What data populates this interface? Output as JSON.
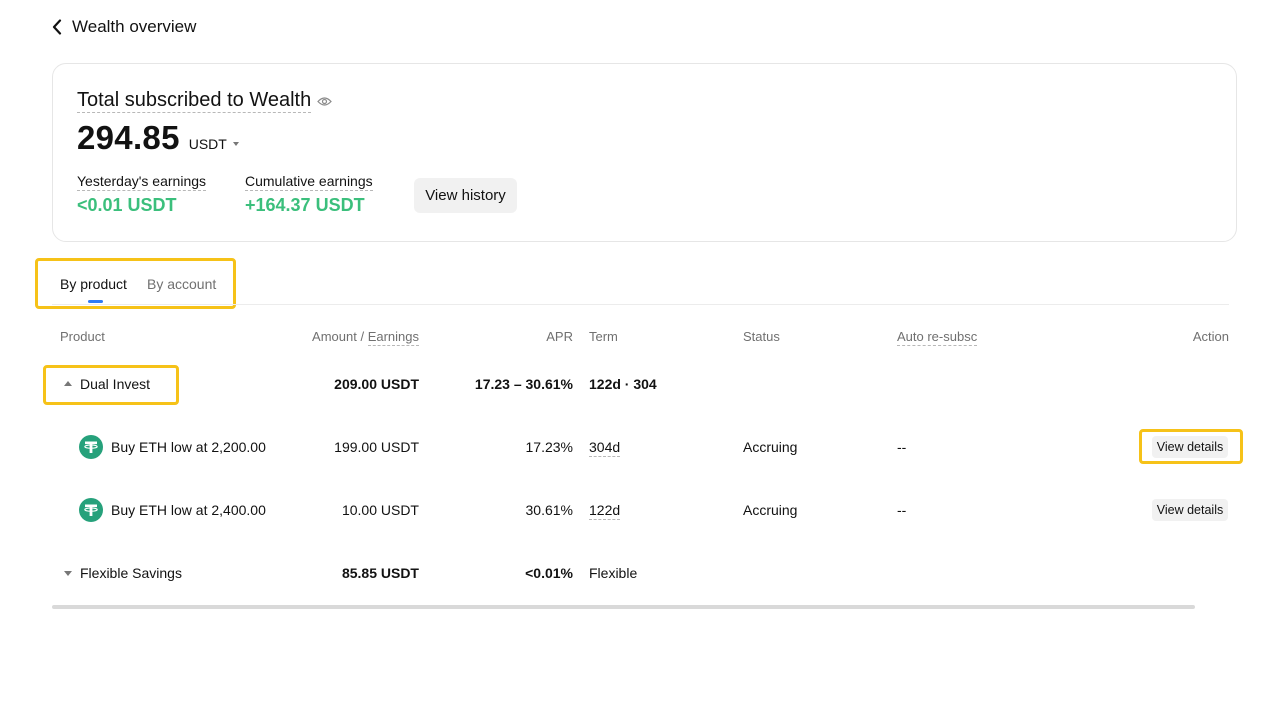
{
  "header": {
    "back_title": "Wealth overview"
  },
  "summary": {
    "title": "Total subscribed to Wealth",
    "amount": "294.85",
    "currency": "USDT",
    "yesterday_label": "Yesterday's earnings",
    "yesterday_value": "<0.01 USDT",
    "cumulative_label": "Cumulative earnings",
    "cumulative_value": "+164.37 USDT",
    "history_button": "View history"
  },
  "tabs": [
    {
      "label": "By product",
      "active": true
    },
    {
      "label": "By account",
      "active": false
    }
  ],
  "table": {
    "headers": {
      "product": "Product",
      "amount": "Amount /",
      "earnings": "Earnings",
      "apr": "APR",
      "term": "Term",
      "status": "Status",
      "auto": "Auto re-subsc",
      "action": "Action"
    },
    "groups": [
      {
        "name": "Dual Invest",
        "amount": "209.00 USDT",
        "apr": "17.23 – 30.61%",
        "term": "122d · 304",
        "expanded": true,
        "rows": [
          {
            "product": "Buy ETH low at 2,200.00",
            "amount": "199.00 USDT",
            "apr": "17.23%",
            "term": "304d",
            "status": "Accruing",
            "auto": "--",
            "action": "View details"
          },
          {
            "product": "Buy ETH low at 2,400.00",
            "amount": "10.00 USDT",
            "apr": "30.61%",
            "term": "122d",
            "status": "Accruing",
            "auto": "--",
            "action": "View details"
          }
        ]
      },
      {
        "name": "Flexible Savings",
        "amount": "85.85 USDT",
        "apr": "<0.01%",
        "term": "Flexible",
        "expanded": false,
        "rows": []
      }
    ]
  },
  "icons": {
    "back": "chevron-left-icon",
    "eye": "eye-icon",
    "token": "tether-icon"
  },
  "colors": {
    "positive": "#3bbf7c",
    "accent_tab": "#2f7bf6",
    "highlight": "#f6c218",
    "token": "#26a17b"
  }
}
